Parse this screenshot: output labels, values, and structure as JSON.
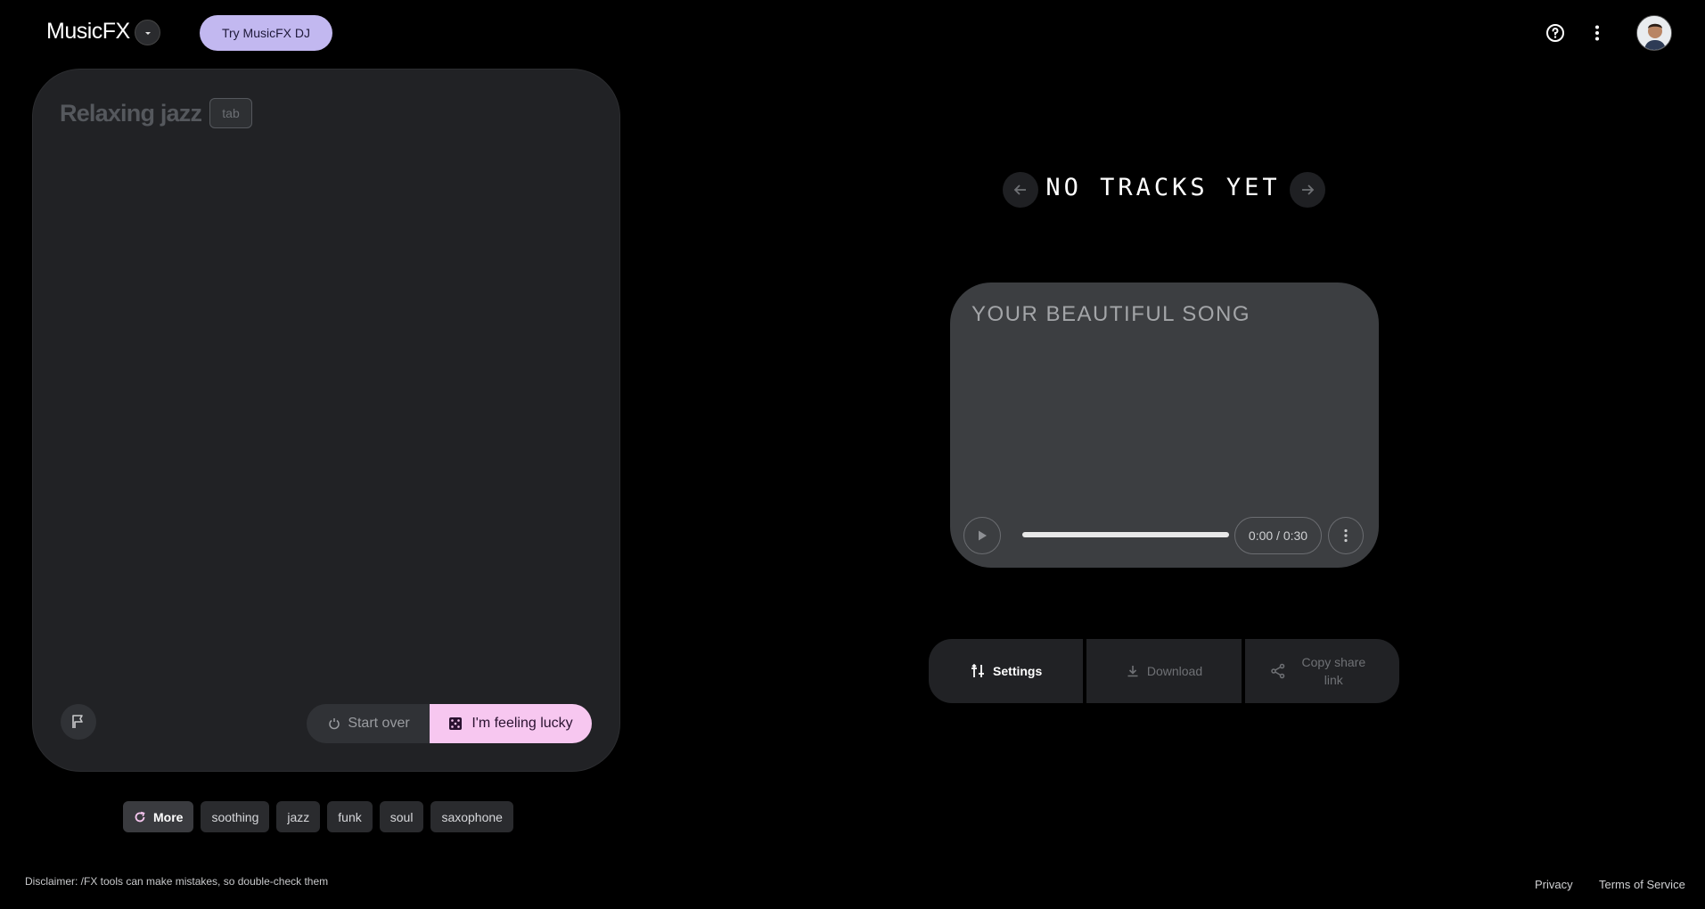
{
  "header": {
    "app_name": "MusicFX",
    "try_dj_label": "Try MusicFX DJ"
  },
  "prompt": {
    "placeholder": "Relaxing jazz",
    "tab_hint": "tab",
    "start_over_label": "Start over",
    "lucky_label": "I'm feeling lucky"
  },
  "chips": {
    "more_label": "More",
    "items": [
      "soothing",
      "jazz",
      "funk",
      "soul",
      "saxophone"
    ]
  },
  "player": {
    "tracks_title": "NO TRACKS YET",
    "song_title": "YOUR BEAUTIFUL SONG",
    "time": "0:00 / 0:30",
    "progress": 0
  },
  "actions": {
    "settings_label": "Settings",
    "download_label": "Download",
    "copy_link_label": "Copy share link"
  },
  "footer": {
    "disclaimer": "Disclaimer: /FX tools can make mistakes, so double-check them",
    "privacy": "Privacy",
    "terms": "Terms of Service"
  },
  "colors": {
    "background": "#000000",
    "panel": "#212225",
    "try_dj_accent": "#c2b8f0",
    "lucky_accent": "#f7c7f0",
    "song_card": "#3c3e41"
  },
  "icons": [
    "chevron-down-icon",
    "help-icon",
    "more-vert-icon",
    "flag-icon",
    "reset-icon",
    "dice-icon",
    "refresh-icon",
    "arrow-left-icon",
    "arrow-right-icon",
    "play-icon",
    "tune-icon",
    "download-icon",
    "share-icon"
  ]
}
